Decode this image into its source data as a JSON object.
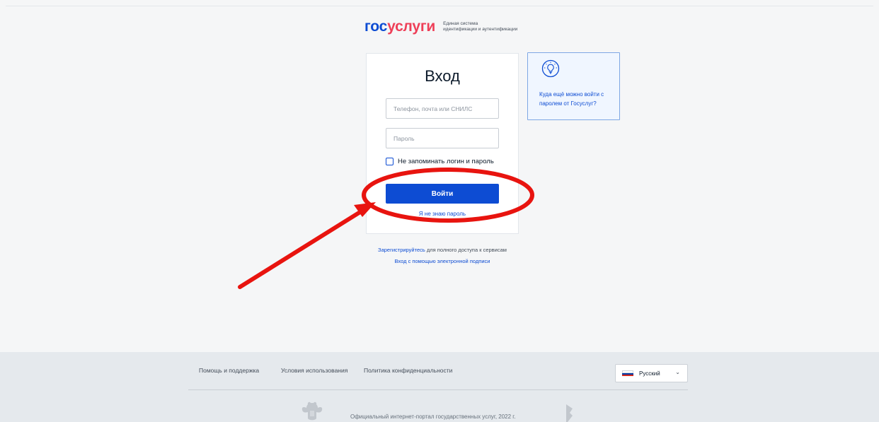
{
  "header": {
    "logo_gos": "гос",
    "logo_uslugi": "услуги",
    "logo_sub_line1": "Единая система",
    "logo_sub_line2": "идентификации и аутентификации"
  },
  "login": {
    "title": "Вход",
    "login_placeholder": "Телефон, почта или СНИЛС",
    "password_placeholder": "Пароль",
    "remember_label": "Не запоминать логин и пароль",
    "submit_label": "Войти",
    "forgot_label": "Я не знаю пароль"
  },
  "info": {
    "icon": "lightbulb-icon",
    "text": "Куда ещё можно войти с паролем от Госуслуг?"
  },
  "links": {
    "register_link": "Зарегистрируйтесь",
    "register_rest": " для полного доступа к сервисам",
    "signature_link": "Вход с помощью электронной подписи"
  },
  "footer": {
    "help": "Помощь и поддержка",
    "terms": "Условия использования",
    "privacy": "Политика конфиденциальности",
    "language": "Русский",
    "copyright": "Официальный интернет-портал государственных услуг, 2022 г."
  },
  "colors": {
    "brand_blue": "#0d4cd3",
    "brand_red": "#ee3f58",
    "annotation_red": "#e8140f"
  }
}
